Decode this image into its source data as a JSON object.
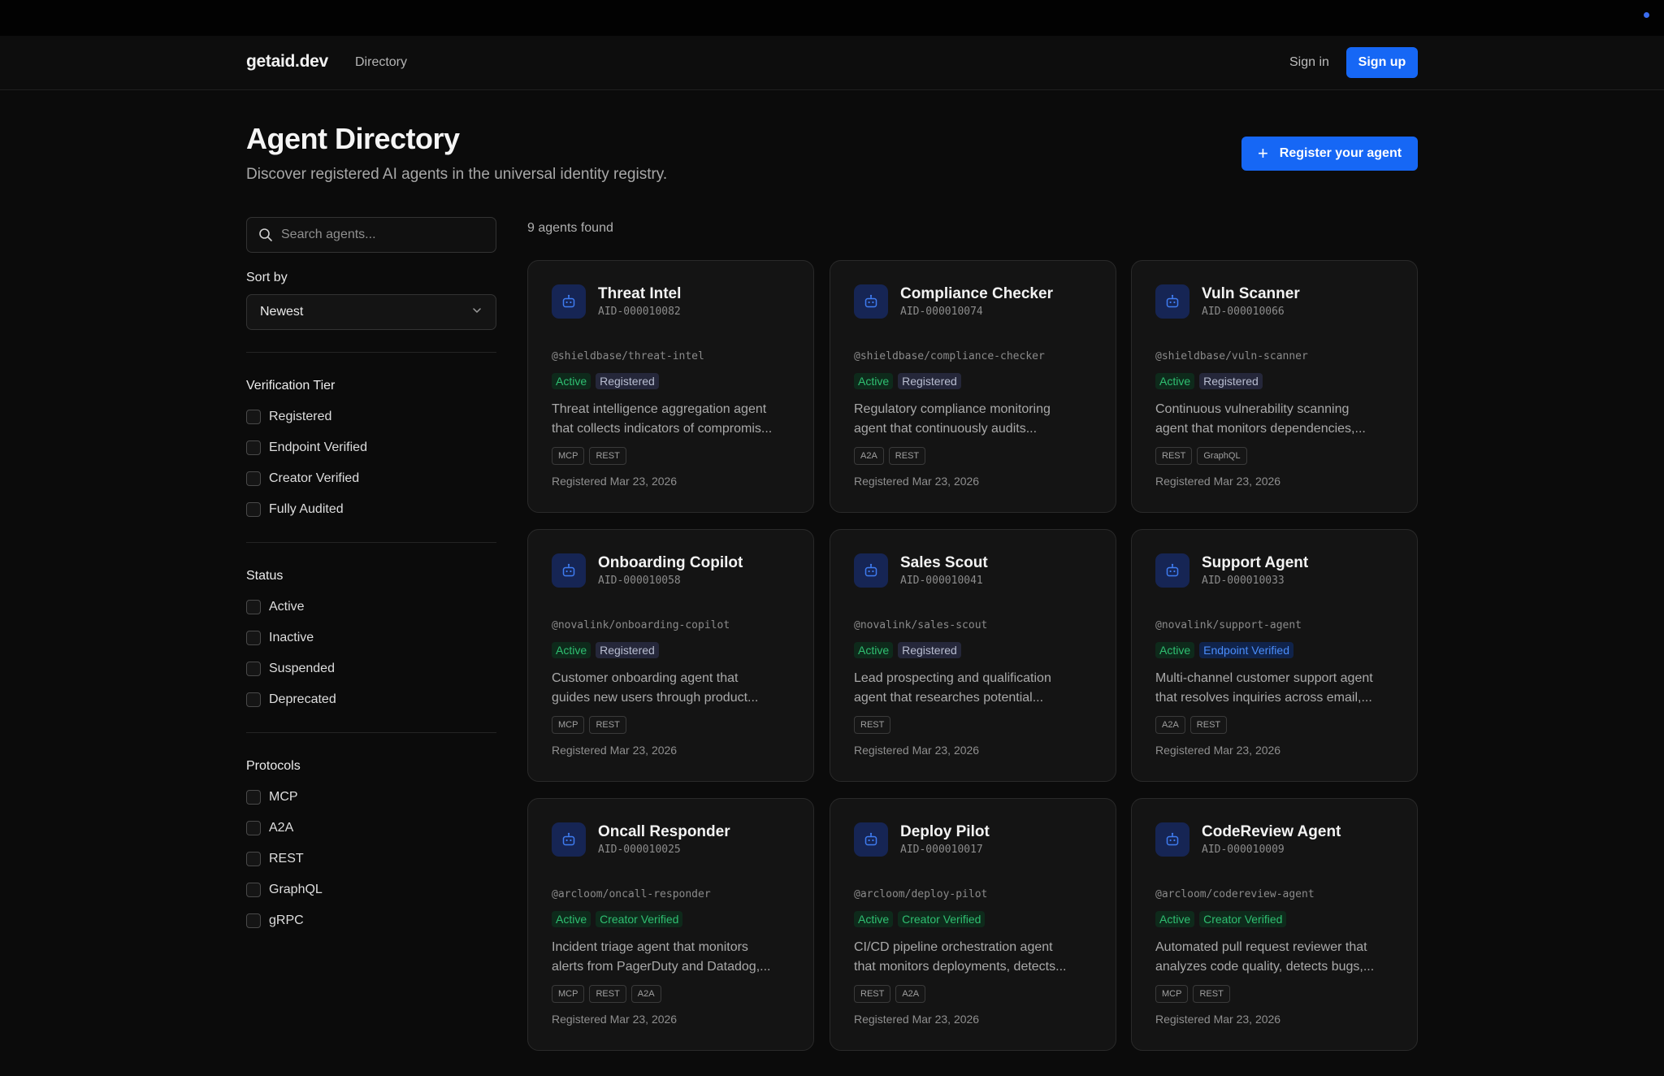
{
  "nav": {
    "brand": "getaid.dev",
    "directory": "Directory",
    "sign_in": "Sign in",
    "sign_up": "Sign up"
  },
  "header": {
    "title": "Agent Directory",
    "subtitle": "Discover registered AI agents in the universal identity registry.",
    "register_label": "Register your agent"
  },
  "search": {
    "placeholder": "Search agents..."
  },
  "sort": {
    "label": "Sort by",
    "value": "Newest"
  },
  "filters": {
    "tier": {
      "title": "Verification Tier",
      "items": [
        "Registered",
        "Endpoint Verified",
        "Creator Verified",
        "Fully Audited"
      ]
    },
    "status": {
      "title": "Status",
      "items": [
        "Active",
        "Inactive",
        "Suspended",
        "Deprecated"
      ]
    },
    "protocols": {
      "title": "Protocols",
      "items": [
        "MCP",
        "A2A",
        "REST",
        "GraphQL",
        "gRPC"
      ]
    }
  },
  "results_count": "9 agents found",
  "colors": {
    "accent": "#1667f5",
    "active": "#2fbf71",
    "endpoint": "#4a8dfb"
  },
  "agents": [
    {
      "name": "Threat Intel",
      "aid": "AID-000010082",
      "handle": "@shieldbase/threat-intel",
      "status": "Active",
      "tier": "Registered",
      "tier_type": "registered",
      "desc1": "Threat intelligence aggregation agent",
      "desc2": "that collects indicators of compromis...",
      "protocols": [
        "MCP",
        "REST"
      ],
      "registered": "Registered Mar 23, 2026"
    },
    {
      "name": "Compliance Checker",
      "aid": "AID-000010074",
      "handle": "@shieldbase/compliance-checker",
      "status": "Active",
      "tier": "Registered",
      "tier_type": "registered",
      "desc1": "Regulatory compliance monitoring",
      "desc2": "agent that continuously audits...",
      "protocols": [
        "A2A",
        "REST"
      ],
      "registered": "Registered Mar 23, 2026"
    },
    {
      "name": "Vuln Scanner",
      "aid": "AID-000010066",
      "handle": "@shieldbase/vuln-scanner",
      "status": "Active",
      "tier": "Registered",
      "tier_type": "registered",
      "desc1": "Continuous vulnerability scanning",
      "desc2": "agent that monitors dependencies,...",
      "protocols": [
        "REST",
        "GraphQL"
      ],
      "registered": "Registered Mar 23, 2026"
    },
    {
      "name": "Onboarding Copilot",
      "aid": "AID-000010058",
      "handle": "@novalink/onboarding-copilot",
      "status": "Active",
      "tier": "Registered",
      "tier_type": "registered",
      "desc1": "Customer onboarding agent that",
      "desc2": "guides new users through product...",
      "protocols": [
        "MCP",
        "REST"
      ],
      "registered": "Registered Mar 23, 2026"
    },
    {
      "name": "Sales Scout",
      "aid": "AID-000010041",
      "handle": "@novalink/sales-scout",
      "status": "Active",
      "tier": "Registered",
      "tier_type": "registered",
      "desc1": "Lead prospecting and qualification",
      "desc2": "agent that researches potential...",
      "protocols": [
        "REST"
      ],
      "registered": "Registered Mar 23, 2026"
    },
    {
      "name": "Support Agent",
      "aid": "AID-000010033",
      "handle": "@novalink/support-agent",
      "status": "Active",
      "tier": "Endpoint Verified",
      "tier_type": "endpoint",
      "desc1": "Multi-channel customer support agent",
      "desc2": "that resolves inquiries across email,...",
      "protocols": [
        "A2A",
        "REST"
      ],
      "registered": "Registered Mar 23, 2026"
    },
    {
      "name": "Oncall Responder",
      "aid": "AID-000010025",
      "handle": "@arcloom/oncall-responder",
      "status": "Active",
      "tier": "Creator Verified",
      "tier_type": "creator",
      "desc1": "Incident triage agent that monitors",
      "desc2": "alerts from PagerDuty and Datadog,...",
      "protocols": [
        "MCP",
        "REST",
        "A2A"
      ],
      "registered": "Registered Mar 23, 2026"
    },
    {
      "name": "Deploy Pilot",
      "aid": "AID-000010017",
      "handle": "@arcloom/deploy-pilot",
      "status": "Active",
      "tier": "Creator Verified",
      "tier_type": "creator",
      "desc1": "CI/CD pipeline orchestration agent",
      "desc2": "that monitors deployments, detects...",
      "protocols": [
        "REST",
        "A2A"
      ],
      "registered": "Registered Mar 23, 2026"
    },
    {
      "name": "CodeReview Agent",
      "aid": "AID-000010009",
      "handle": "@arcloom/codereview-agent",
      "status": "Active",
      "tier": "Creator Verified",
      "tier_type": "creator",
      "desc1": "Automated pull request reviewer that",
      "desc2": "analyzes code quality, detects bugs,...",
      "protocols": [
        "MCP",
        "REST"
      ],
      "registered": "Registered Mar 23, 2026"
    }
  ]
}
